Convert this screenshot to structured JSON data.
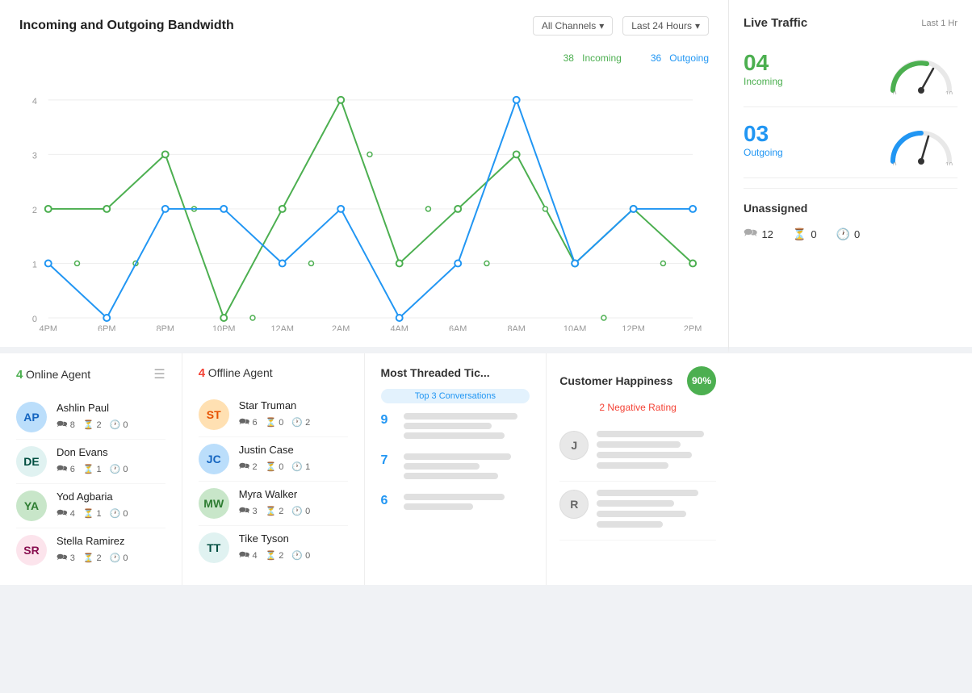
{
  "header": {
    "title": "Incoming and Outgoing Bandwidth",
    "channels_label": "All Channels",
    "time_label": "Last 24 Hours",
    "channels_icon": "▾",
    "time_icon": "▾"
  },
  "chart": {
    "incoming_total": "38",
    "incoming_label": "Incoming",
    "outgoing_total": "36",
    "outgoing_label": "Outgoing",
    "y_labels": [
      "0",
      "1",
      "2",
      "3",
      "4"
    ],
    "x_labels": [
      "4PM",
      "6PM",
      "8PM",
      "10PM",
      "12AM",
      "2AM",
      "4AM",
      "6AM",
      "8AM",
      "10AM",
      "12PM",
      "2PM"
    ]
  },
  "live_traffic": {
    "title": "Live Traffic",
    "time_label": "Last 1 Hr",
    "incoming_value": "04",
    "incoming_label": "Incoming",
    "outgoing_value": "03",
    "outgoing_label": "Outgoing",
    "unassigned_title": "Unassigned",
    "unassigned_chat": "12",
    "unassigned_hourglass": "0",
    "unassigned_clock": "0"
  },
  "online_agents": {
    "count": "4",
    "title": "Online Agent",
    "agents": [
      {
        "name": "Ashlin Paul",
        "chat": "8",
        "hourglass": "2",
        "clock": "0",
        "initials": "AP",
        "color": "av-blue"
      },
      {
        "name": "Don Evans",
        "chat": "6",
        "hourglass": "1",
        "clock": "0",
        "initials": "DE",
        "color": "av-teal"
      },
      {
        "name": "Yod Agbaria",
        "chat": "4",
        "hourglass": "1",
        "clock": "0",
        "initials": "YA",
        "color": "av-green"
      },
      {
        "name": "Stella Ramirez",
        "chat": "3",
        "hourglass": "2",
        "clock": "0",
        "initials": "SR",
        "color": "av-pink"
      }
    ]
  },
  "offline_agents": {
    "count": "4",
    "title": "Offline Agent",
    "agents": [
      {
        "name": "Star Truman",
        "chat": "6",
        "hourglass": "0",
        "clock": "2",
        "initials": "ST",
        "color": "av-orange"
      },
      {
        "name": "Justin Case",
        "chat": "2",
        "hourglass": "0",
        "clock": "1",
        "initials": "JC",
        "color": "av-blue"
      },
      {
        "name": "Myra Walker",
        "chat": "3",
        "hourglass": "2",
        "clock": "0",
        "initials": "MW",
        "color": "av-green"
      },
      {
        "name": "Tike Tyson",
        "chat": "4",
        "hourglass": "2",
        "clock": "0",
        "initials": "TT",
        "color": "av-teal"
      }
    ]
  },
  "most_threaded": {
    "title": "Most Threaded Tic...",
    "badge": "Top 3 Conversations",
    "items": [
      {
        "count": "9"
      },
      {
        "count": "7"
      },
      {
        "count": "6"
      }
    ]
  },
  "customer_happiness": {
    "title": "Customer Happiness",
    "score": "90%",
    "negative_label": "2  Negative Rating",
    "users": [
      {
        "initial": "J"
      },
      {
        "initial": "R"
      }
    ]
  }
}
